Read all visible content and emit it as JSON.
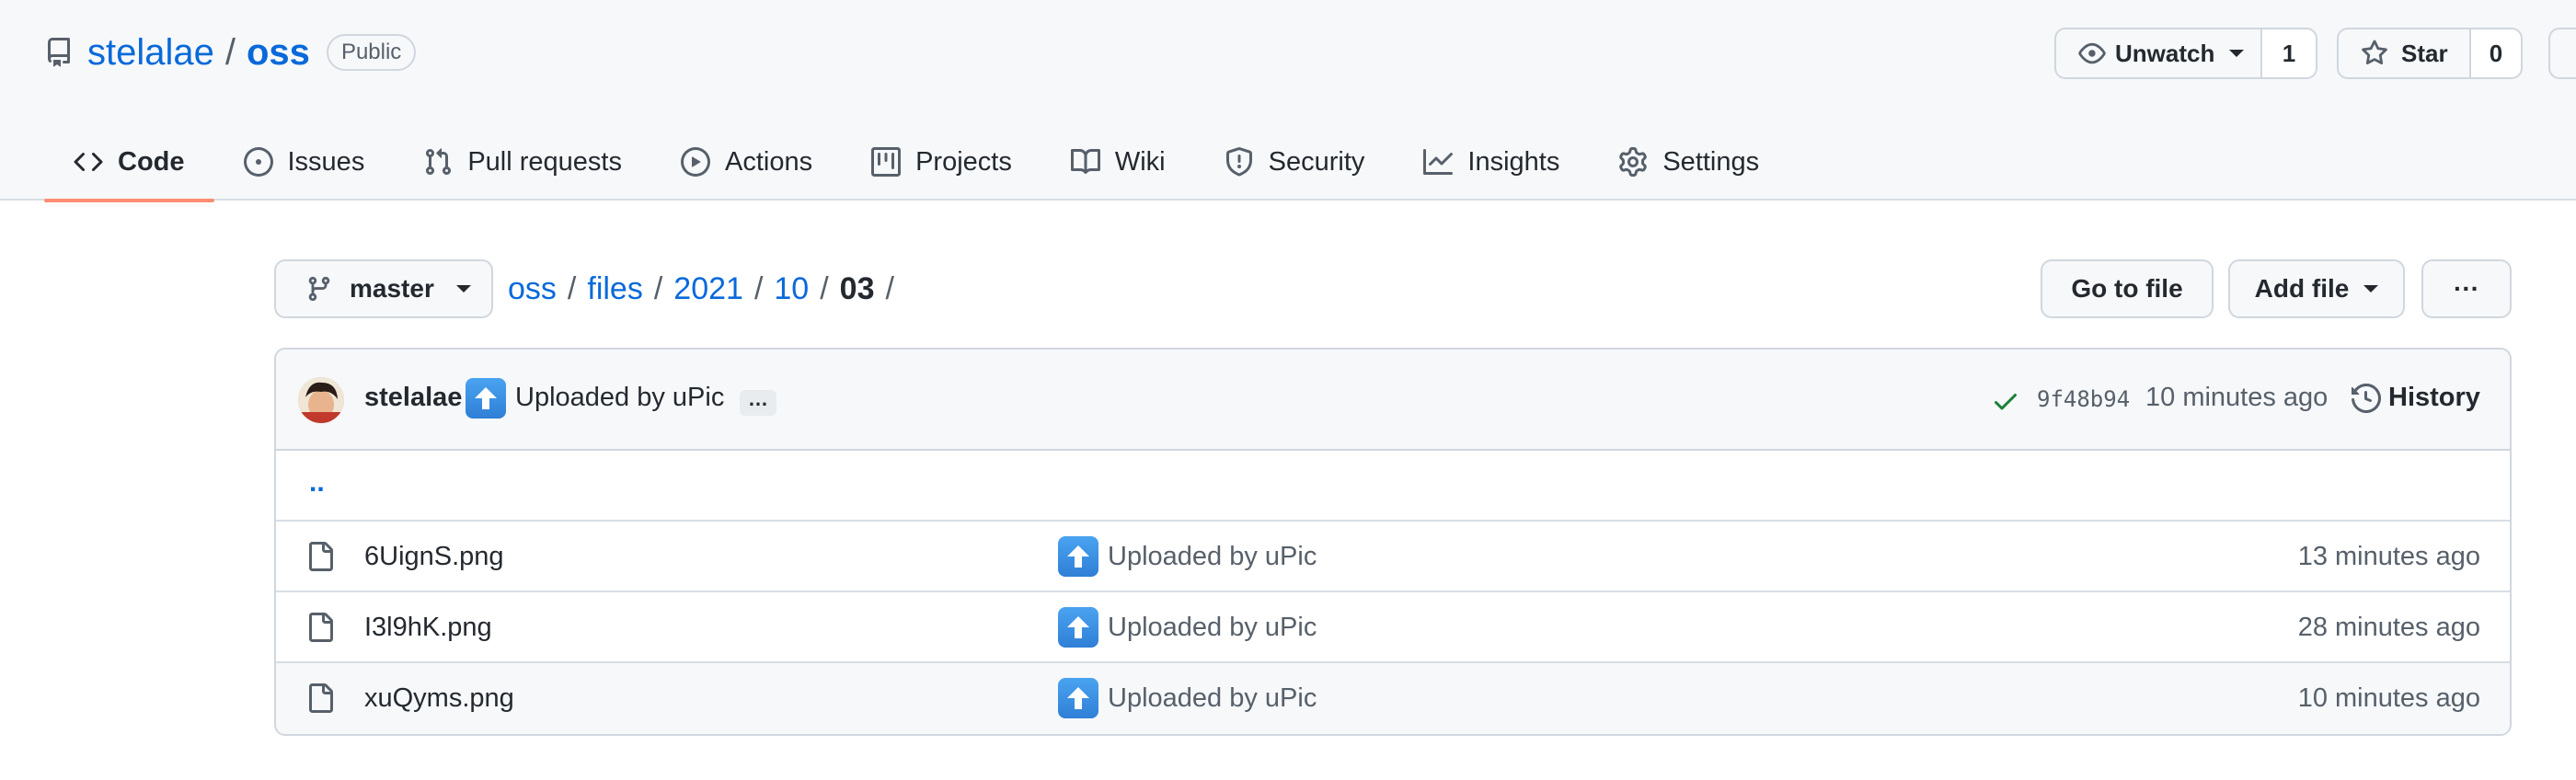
{
  "repo": {
    "owner": "stelalae",
    "separator": "/",
    "name": "oss",
    "visibility": "Public"
  },
  "actions": {
    "watch_label": "Unwatch",
    "watch_count": "1",
    "star_label": "Star",
    "star_count": "0"
  },
  "tabs": [
    {
      "label": "Code",
      "icon": "code-icon",
      "selected": true
    },
    {
      "label": "Issues",
      "icon": "issue-icon"
    },
    {
      "label": "Pull requests",
      "icon": "pull-request-icon"
    },
    {
      "label": "Actions",
      "icon": "play-icon"
    },
    {
      "label": "Projects",
      "icon": "project-icon"
    },
    {
      "label": "Wiki",
      "icon": "book-icon"
    },
    {
      "label": "Security",
      "icon": "shield-icon"
    },
    {
      "label": "Insights",
      "icon": "graph-icon"
    },
    {
      "label": "Settings",
      "icon": "gear-icon"
    }
  ],
  "file_nav": {
    "branch": "master",
    "breadcrumb": [
      "oss",
      "files",
      "2021",
      "10"
    ],
    "separator": "/",
    "current": "03",
    "trailing_sep": "/",
    "go_to_file": "Go to file",
    "add_file": "Add file",
    "more": "···"
  },
  "latest_commit": {
    "author": "stelalae",
    "message": "Uploaded by uPic",
    "ellipsis": "…",
    "sha": "9f48b94",
    "time": "10 minutes ago",
    "history_label": "History"
  },
  "parent_dir": "..",
  "files": [
    {
      "name": "6UignS.png",
      "message": "Uploaded by uPic",
      "time": "13 minutes ago"
    },
    {
      "name": "I3l9hK.png",
      "message": "Uploaded by uPic",
      "time": "28 minutes ago"
    },
    {
      "name": "xuQyms.png",
      "message": "Uploaded by uPic",
      "time": "10 minutes ago"
    }
  ],
  "colors": {
    "link": "#0969da",
    "selected_tab_underline": "#fd8c73",
    "success": "#1a7f37",
    "header_bg": "#f6f8fa"
  }
}
